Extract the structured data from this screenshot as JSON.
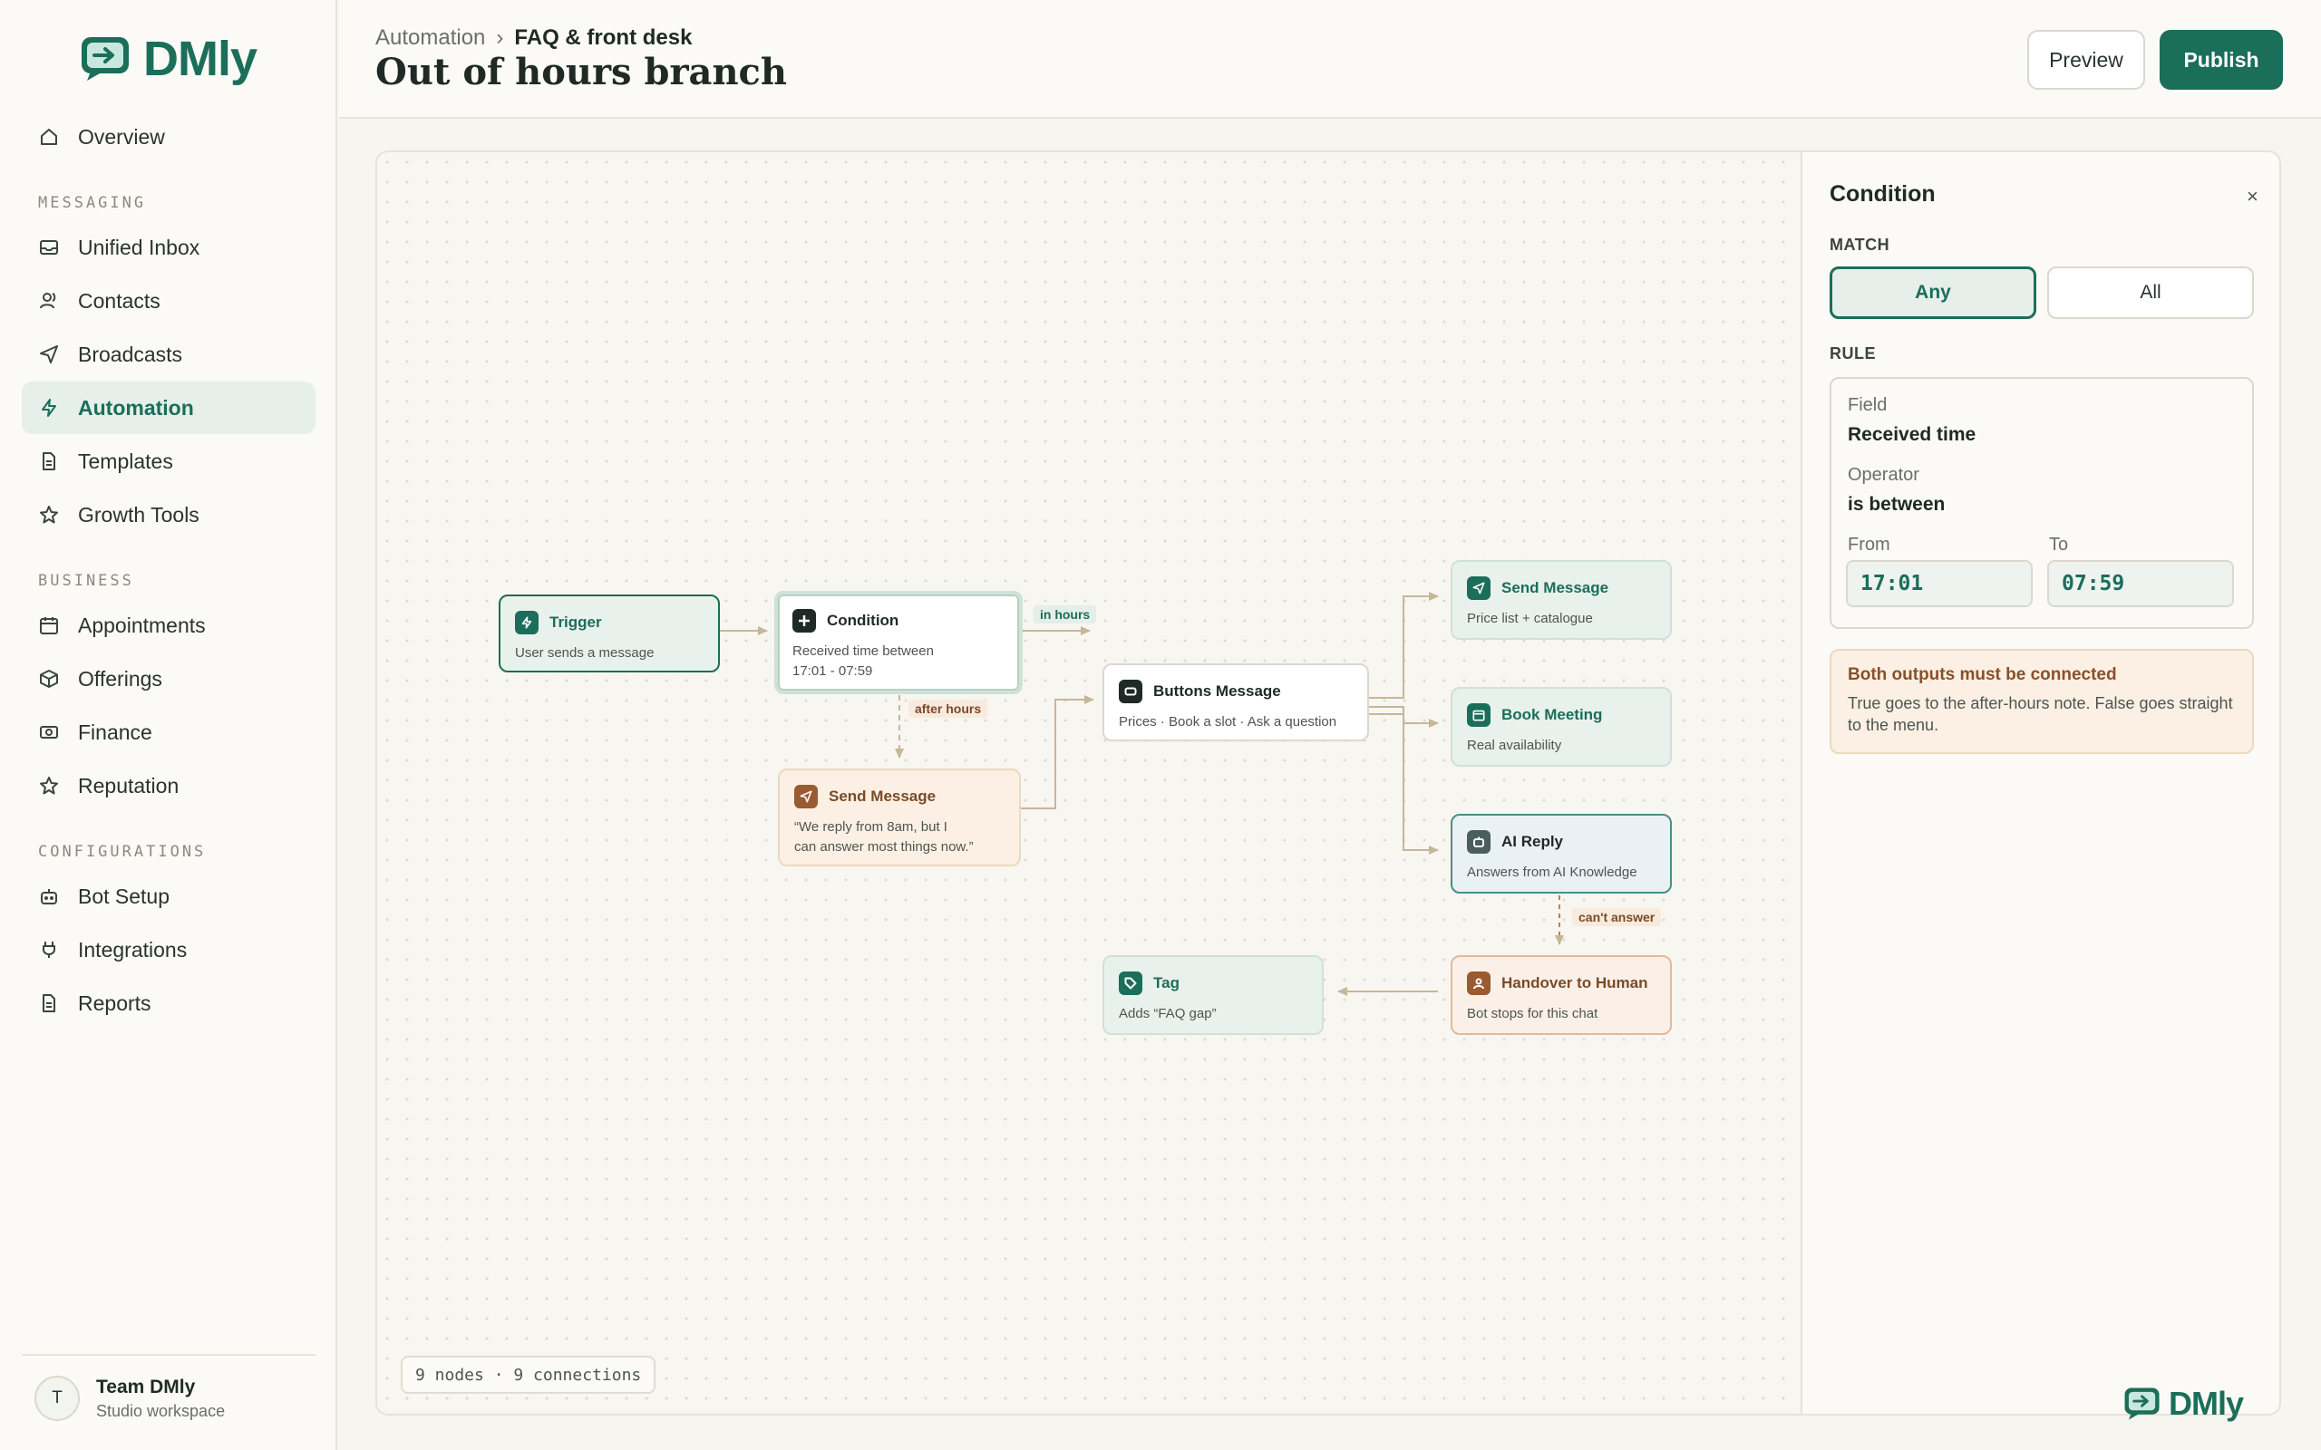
{
  "app": {
    "name": "DMly"
  },
  "sidebar": {
    "overview": "Overview",
    "sections": {
      "messaging": "MESSAGING",
      "business": "BUSINESS",
      "configurations": "CONFIGURATIONS"
    },
    "messaging_items": [
      "Unified Inbox",
      "Contacts",
      "Broadcasts",
      "Automation",
      "Templates",
      "Growth Tools"
    ],
    "business_items": [
      "Appointments",
      "Offerings",
      "Finance",
      "Reputation"
    ],
    "config_items": [
      "Bot Setup",
      "Integrations",
      "Reports"
    ],
    "active": "Automation",
    "user": {
      "initial": "T",
      "name": "Team DMly",
      "workspace": "Studio workspace"
    }
  },
  "header": {
    "breadcrumb": [
      "Automation",
      "FAQ & front desk"
    ],
    "separator": "›",
    "title": "Out of hours branch",
    "preview_label": "Preview",
    "publish_label": "Publish"
  },
  "flow": {
    "nodes": {
      "trigger": {
        "title": "Trigger",
        "subtitle": "User sends a message"
      },
      "condition": {
        "title": "Condition",
        "subtitle_1": "Received time between",
        "subtitle_2": "17:01 - 07:59"
      },
      "after_hours_message": {
        "title": "Send Message",
        "subtitle_1": "“We reply from 8am, but I",
        "subtitle_2": "can answer most things now.”"
      },
      "buttons": {
        "title": "Buttons Message",
        "subtitle": "Prices · Book a slot · Ask a question"
      },
      "price_message": {
        "title": "Send Message",
        "subtitle": "Price list + catalogue"
      },
      "book_meeting": {
        "title": "Book Meeting",
        "subtitle": "Real availability"
      },
      "ai_reply": {
        "title": "AI Reply",
        "subtitle": "Answers from AI Knowledge"
      },
      "handover": {
        "title": "Handover to Human",
        "subtitle": "Bot stops for this chat"
      },
      "tag": {
        "title": "Tag",
        "subtitle": "Adds “FAQ gap”"
      }
    },
    "edge_labels": {
      "in_hours": "in hours",
      "after_hours": "after hours",
      "cant_answer": "can't answer"
    },
    "stats": "9 nodes · 9 connections"
  },
  "inspector": {
    "title": "Condition",
    "close": "×",
    "match_label": "MATCH",
    "match_options": [
      "Any",
      "All"
    ],
    "match_selected": "Any",
    "rule_label": "RULE",
    "rule": {
      "field_label": "Field",
      "field_value": "Received time",
      "operator_label": "Operator",
      "operator_value": "is between",
      "from_label": "From",
      "from_value": "17:01",
      "to_label": "To",
      "to_value": "07:59"
    },
    "warning": {
      "title": "Both outputs must be connected",
      "body": "True goes to the after-hours note. False goes straight to the menu."
    }
  },
  "colors": {
    "brand": "#1b6e5a",
    "warning": "#8a4f2a",
    "canvas_bg": "#f8f6f0"
  }
}
